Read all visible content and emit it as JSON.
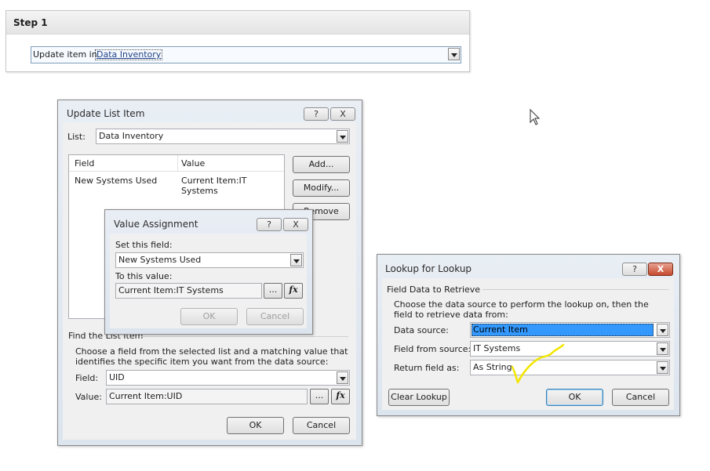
{
  "step": {
    "title": "Step 1",
    "label": "Update item in",
    "link": "Data Inventory"
  },
  "update_dialog": {
    "title": "Update List Item",
    "help": "?",
    "close": "X",
    "list_label": "List:",
    "list_value": "Data Inventory",
    "grid_headers": [
      "Field",
      "Value"
    ],
    "grid_rows": [
      [
        "New Systems Used",
        "Current Item:IT Systems"
      ]
    ],
    "add": "Add...",
    "modify": "Modify...",
    "remove": "Remove",
    "find_section": "Find the List Item",
    "find_desc": "Choose a field from the selected list and a matching value that identifies the specific item you want from the data source:",
    "field_label": "Field:",
    "field_value": "UID",
    "value_label": "Value:",
    "value_value": "Current Item:UID",
    "ellipsis": "...",
    "fx": "fx",
    "ok": "OK",
    "cancel": "Cancel"
  },
  "value_dialog": {
    "title": "Value Assignment",
    "help": "?",
    "close": "X",
    "set_label": "Set this field:",
    "set_value": "New Systems Used",
    "to_label": "To this value:",
    "to_value": "Current Item:IT Systems",
    "ellipsis": "...",
    "fx": "fx",
    "ok": "OK",
    "cancel": "Cancel"
  },
  "lookup_dialog": {
    "title": "Lookup for Lookup",
    "help": "?",
    "close": "X",
    "section": "Field Data to Retrieve",
    "desc": "Choose the data source to perform the lookup on, then the field to retrieve data from:",
    "source_label": "Data source:",
    "source_value": "Current Item",
    "field_label": "Field from source:",
    "field_value": "IT Systems",
    "return_label": "Return field as:",
    "return_value": "As String",
    "clear": "Clear Lookup",
    "ok": "OK",
    "cancel": "Cancel"
  },
  "colors": {
    "annotation": "#f2e600",
    "close_button": "#c74a2d",
    "selection": "#3399ff"
  }
}
